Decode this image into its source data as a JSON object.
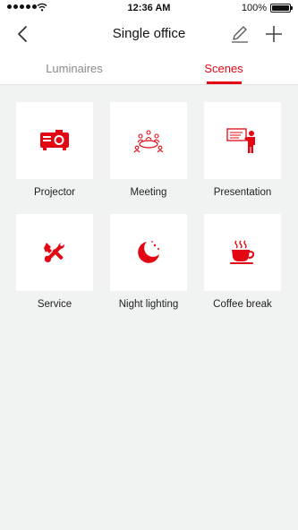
{
  "status_bar": {
    "time": "12:36 AM",
    "battery": "100%"
  },
  "header": {
    "title": "Single office"
  },
  "tabs": [
    {
      "label": "Luminaires",
      "selected": false
    },
    {
      "label": "Scenes",
      "selected": true
    }
  ],
  "scenes": [
    {
      "label": "Projector",
      "icon": "projector-icon"
    },
    {
      "label": "Meeting",
      "icon": "meeting-icon"
    },
    {
      "label": "Presentation",
      "icon": "presentation-icon"
    },
    {
      "label": "Service",
      "icon": "service-tools-icon"
    },
    {
      "label": "Night lighting",
      "icon": "moon-icon"
    },
    {
      "label": "Coffee break",
      "icon": "coffee-cup-icon"
    }
  ],
  "colors": {
    "accent": "#e30613",
    "background": "#f1f2f2",
    "tile": "#ffffff"
  }
}
